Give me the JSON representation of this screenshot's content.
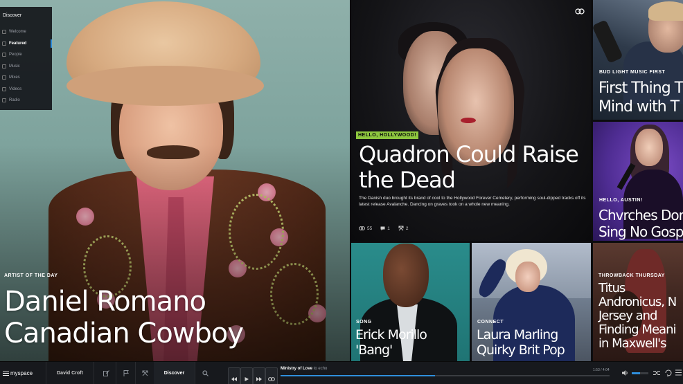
{
  "sidebar": {
    "heading": "Discover",
    "items": [
      {
        "label": "Welcome",
        "active": false
      },
      {
        "label": "Featured",
        "active": true
      },
      {
        "label": "People",
        "active": false
      },
      {
        "label": "Music",
        "active": false
      },
      {
        "label": "Mixes",
        "active": false
      },
      {
        "label": "Videos",
        "active": false
      },
      {
        "label": "Radio",
        "active": false
      }
    ]
  },
  "hero": {
    "kicker": "ARTIST OF THE DAY",
    "title_line1": "Daniel Romano",
    "title_line2": "Canadian Cowboy"
  },
  "quadron": {
    "kicker": "HELLO, HOLLYWOOD!",
    "title": "Quadron Could Raise the Dead",
    "description": "The Danish duo brought its brand of cool to the Hollywood Forever Cemetery, performing soul-dipped tracks off its latest release Avalanche. Dancing on graves took on a whole new meaning.",
    "views": "55",
    "comments": "1",
    "connects": "2",
    "kicker_color": "#8dc63f"
  },
  "tiles": {
    "budlight": {
      "kicker": "BUD LIGHT MUSIC FIRST",
      "title_line1": "First Thing T",
      "title_line2": "Mind with T"
    },
    "churches": {
      "kicker": "HELLO, AUSTIN!",
      "title_line1": "Chvrches Dor",
      "title_line2": "Sing No Gosp"
    },
    "erick": {
      "kicker": "SONG",
      "title_line1": "Erick Morillo",
      "title_line2": "'Bang'"
    },
    "laura": {
      "kicker": "CONNECT",
      "title_line1": "Laura Marling",
      "title_line2": "Quirky Brit Pop"
    },
    "titus": {
      "kicker": "THROWBACK THURSDAY",
      "title_line1": "Titus",
      "title_line2": "Andronicus, N",
      "title_line3": "Jersey and",
      "title_line4": "Finding Meani",
      "title_line5": "in Maxwell's"
    }
  },
  "bottombar": {
    "logo": "myspace",
    "user": "David Croft",
    "discover": "Discover",
    "now_playing_title": "Ministry of Love",
    "now_playing_artist": "to echo",
    "time": "1:53 / 4:04",
    "progress": 0.47,
    "volume": 0.5,
    "accent": "#2f8fdc"
  }
}
